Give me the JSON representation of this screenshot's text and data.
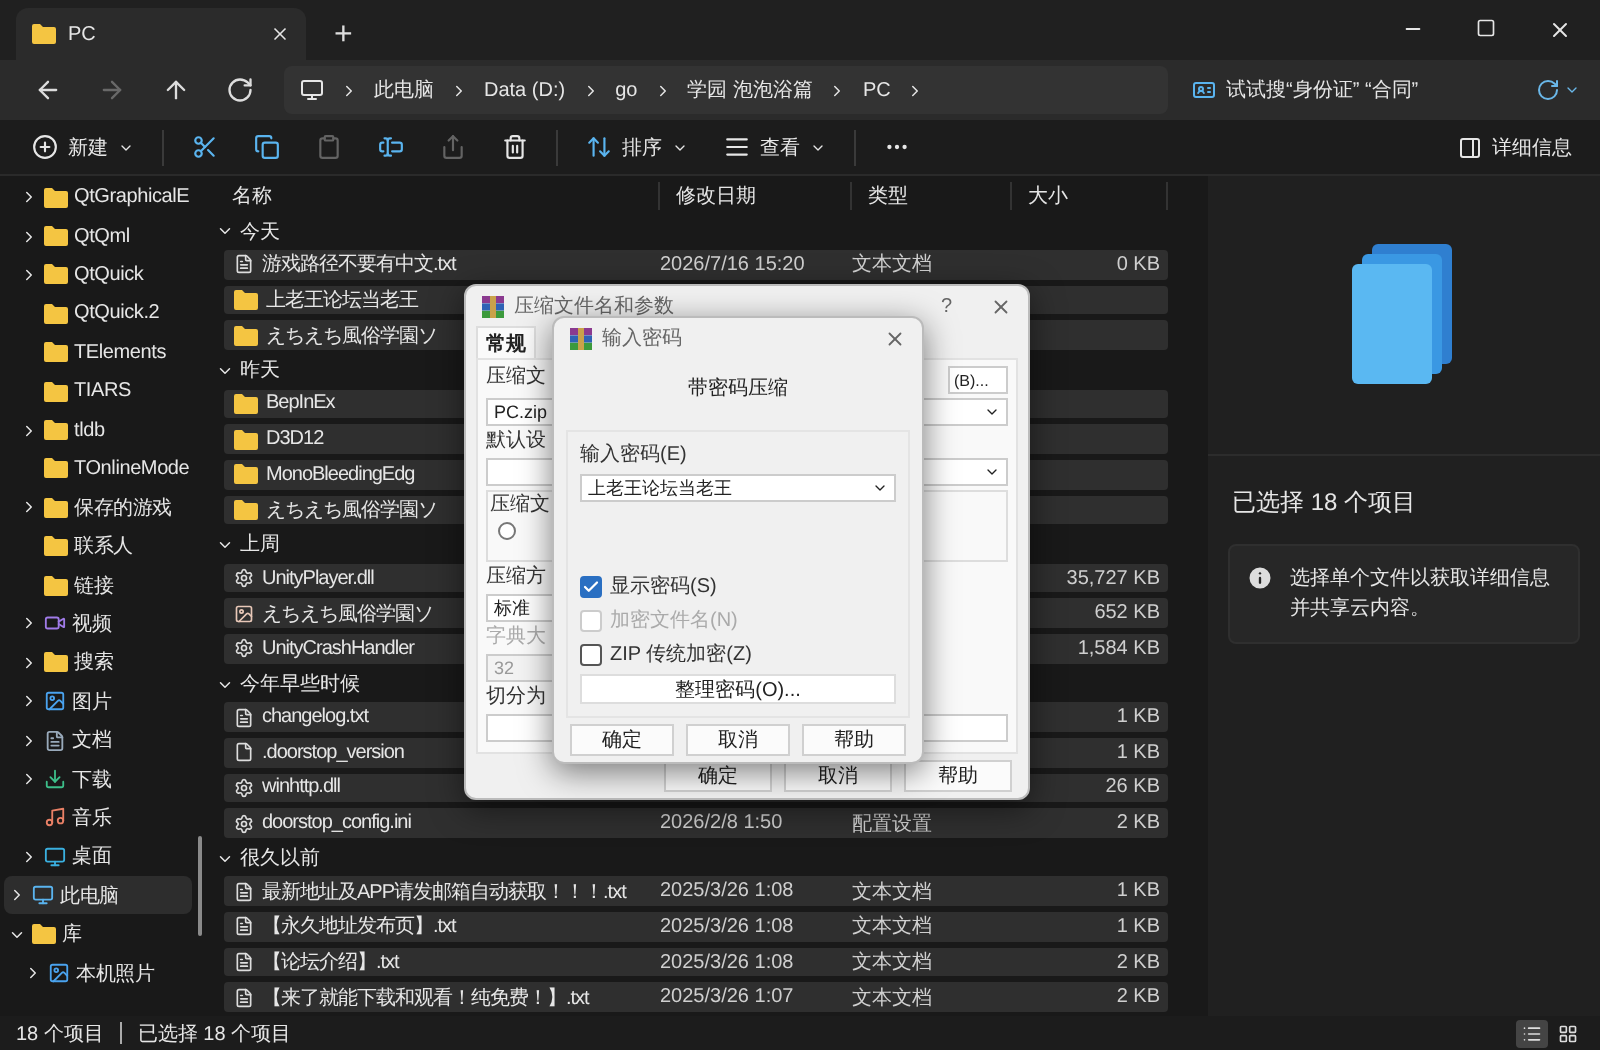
{
  "tab": {
    "title": "PC",
    "add": "+"
  },
  "nav": [
    {
      "kind": "back",
      "disabled": false
    },
    {
      "kind": "forward",
      "disabled": true
    },
    {
      "kind": "up",
      "disabled": false
    },
    {
      "kind": "refresh",
      "disabled": false
    }
  ],
  "breadcrumbs": [
    "此电脑",
    "Data (D:)",
    "go",
    "学园 泡泡浴篇",
    "PC"
  ],
  "search": {
    "placeholder": "试试搜“身份证” “合同”"
  },
  "toolbar": [
    {
      "kind": "menu",
      "label": "新建",
      "disabled": false
    },
    {
      "kind": "cut",
      "disabled": false
    },
    {
      "kind": "copy",
      "disabled": false
    },
    {
      "kind": "paste",
      "disabled": true
    },
    {
      "kind": "rename",
      "disabled": false
    },
    {
      "kind": "share",
      "disabled": true
    },
    {
      "kind": "delete",
      "disabled": false
    },
    {
      "kind": "menu",
      "label": "排序",
      "disabled": false
    },
    {
      "kind": "menu",
      "label": "查看",
      "disabled": false
    },
    {
      "kind": "more",
      "disabled": false
    }
  ],
  "details_button": "详细信息",
  "sidebar": {
    "nested_items": [
      {
        "label": "QtGraphicalE",
        "kind": "folder",
        "expandable": true,
        "expanded": false
      },
      {
        "label": "QtQml",
        "kind": "folder",
        "expandable": true,
        "expanded": false
      },
      {
        "label": "QtQuick",
        "kind": "folder",
        "expandable": true,
        "expanded": false
      },
      {
        "label": "QtQuick.2",
        "kind": "folder",
        "expandable": false
      },
      {
        "label": "TElements",
        "kind": "folder",
        "expandable": false
      },
      {
        "label": "TIARS",
        "kind": "folder",
        "expandable": false
      },
      {
        "label": "tldb",
        "kind": "folder",
        "expandable": true,
        "expanded": false
      },
      {
        "label": "TOnlineMode",
        "kind": "folder",
        "expandable": false
      },
      {
        "label": "保存的游戏",
        "kind": "folder",
        "expandable": true,
        "expanded": false
      },
      {
        "label": "联系人",
        "kind": "folder",
        "expandable": false
      },
      {
        "label": "链接",
        "kind": "folder",
        "expandable": false
      },
      {
        "label": "视频",
        "kind": "video",
        "expandable": true,
        "expanded": false
      },
      {
        "label": "搜索",
        "kind": "folder",
        "expandable": true,
        "expanded": false
      },
      {
        "label": "图片",
        "kind": "pictures",
        "expandable": true,
        "expanded": false
      },
      {
        "label": "文档",
        "kind": "documents",
        "expandable": true,
        "expanded": false
      },
      {
        "label": "下载",
        "kind": "download",
        "expandable": true,
        "expanded": false
      },
      {
        "label": "音乐",
        "kind": "music",
        "expandable": false
      },
      {
        "label": "桌面",
        "kind": "desktop",
        "expandable": true,
        "expanded": false
      }
    ],
    "items": [
      {
        "label": "此电脑",
        "kind": "pc",
        "expandable": true,
        "expanded": false,
        "selected": true
      },
      {
        "label": "库",
        "kind": "folder",
        "expandable": true,
        "expanded": true,
        "selected": false,
        "children": [
          {
            "label": "本机照片",
            "kind": "pictures",
            "expandable": true,
            "expanded": false,
            "selected": false
          }
        ]
      }
    ]
  },
  "columns": [
    "名称",
    "修改日期",
    "类型",
    "大小"
  ],
  "groups": [
    {
      "label": "今天",
      "expanded": true,
      "rows": [
        {
          "name": "游戏路径不要有中文.txt",
          "kind": "text",
          "date": "2026/7/16 15:20",
          "type": "文本文档",
          "size": "0 KB",
          "selected": true
        },
        {
          "name": "上老王论坛当老王",
          "kind": "folder",
          "selected": true
        },
        {
          "name": "えちえち風俗学園ソ",
          "kind": "folder",
          "selected": true
        }
      ]
    },
    {
      "label": "昨天",
      "expanded": true,
      "rows": [
        {
          "name": "BepInEx",
          "kind": "folder",
          "selected": true
        },
        {
          "name": "D3D12",
          "kind": "folder",
          "selected": true
        },
        {
          "name": "MonoBleedingEdg",
          "kind": "folder",
          "selected": true
        },
        {
          "name": "えちえち風俗学園ソ",
          "kind": "folder",
          "selected": true
        }
      ]
    },
    {
      "label": "上周",
      "expanded": true,
      "rows": [
        {
          "name": "UnityPlayer.dll",
          "kind": "dll",
          "size": "35,727 KB",
          "selected": true
        },
        {
          "name": "えちえち風俗学園ソ",
          "kind": "image",
          "size": "652 KB",
          "selected": true
        },
        {
          "name": "UnityCrashHandler",
          "kind": "app",
          "size": "1,584 KB",
          "selected": true
        }
      ]
    },
    {
      "label": "今年早些时候",
      "expanded": true,
      "rows": [
        {
          "name": "changelog.txt",
          "kind": "text",
          "size": "1 KB",
          "selected": true
        },
        {
          "name": ".doorstop_version",
          "kind": "file",
          "size": "1 KB",
          "selected": true
        },
        {
          "name": "winhttp.dll",
          "kind": "dll",
          "size": "26 KB",
          "selected": true
        },
        {
          "name": "doorstop_config.ini",
          "kind": "ini",
          "date": "2026/2/8 1:50",
          "type": "配置设置",
          "size": "2 KB",
          "selected": true
        }
      ]
    },
    {
      "label": "很久以前",
      "expanded": true,
      "rows": [
        {
          "name": "最新地址及APP请发邮箱自动获取！！！.txt",
          "kind": "text",
          "date": "2025/3/26 1:08",
          "type": "文本文档",
          "size": "1 KB",
          "selected": true
        },
        {
          "name": "【永久地址发布页】.txt",
          "kind": "text",
          "date": "2025/3/26 1:08",
          "type": "文本文档",
          "size": "1 KB",
          "selected": true
        },
        {
          "name": "【论坛介绍】.txt",
          "kind": "text",
          "date": "2025/3/26 1:08",
          "type": "文本文档",
          "size": "2 KB",
          "selected": true
        },
        {
          "name": "【来了就能下载和观看！纯免费！】.txt",
          "kind": "text",
          "date": "2025/3/26 1:07",
          "type": "文本文档",
          "size": "2 KB",
          "selected": true
        }
      ]
    }
  ],
  "details_pane": {
    "title": "已选择 18 个项目",
    "info": "选择单个文件以获取详细信息并共享云内容。"
  },
  "status_bar": {
    "count": "18 个项目",
    "selection": "已选择 18 个项目",
    "views": [
      {
        "kind": "details",
        "selected": true
      },
      {
        "kind": "tiles",
        "selected": false
      }
    ]
  },
  "archive_dialog": {
    "title": "压缩文件名和参数",
    "help": "?",
    "tabs": [
      {
        "label": "常规",
        "selected": true
      }
    ],
    "name_label": "压缩文",
    "name_value": "PC.zip",
    "browse": "(B)...",
    "profile_label": "默认设",
    "format_label": "压缩文",
    "format_radio_selected": false,
    "method_label": "压缩方",
    "method_value": "标准",
    "dictionary": {
      "label": "字典大",
      "value": "32",
      "disabled": true
    },
    "split_label": "切分为",
    "buttons": [
      "确定",
      "取消",
      "帮助"
    ]
  },
  "password_dialog": {
    "title": "输入密码",
    "heading": "带密码压缩",
    "label": "输入密码(E)",
    "value": "上老王论坛当老王",
    "options": [
      {
        "label": "显示密码(S)",
        "checked": true,
        "disabled": false
      },
      {
        "label": "加密文件名(N)",
        "checked": false,
        "disabled": true
      },
      {
        "label": "ZIP 传统加密(Z)",
        "checked": false,
        "disabled": false
      }
    ],
    "manage_button": "整理密码(O)...",
    "buttons": [
      "确定",
      "取消",
      "帮助"
    ]
  }
}
